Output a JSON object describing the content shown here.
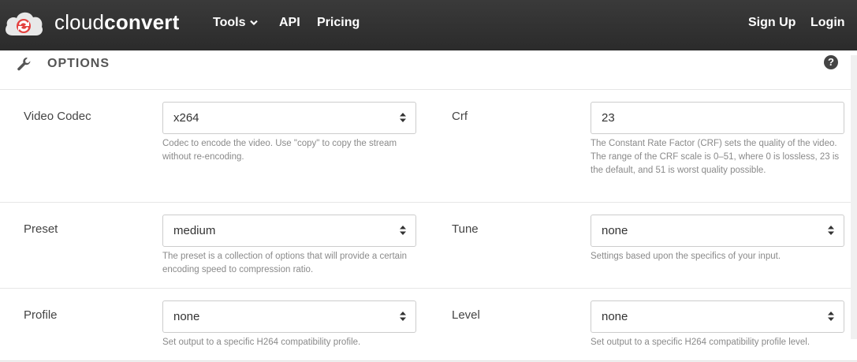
{
  "brand": {
    "light": "cloud",
    "bold": "convert"
  },
  "nav": {
    "tools": "Tools",
    "api": "API",
    "pricing": "Pricing",
    "signup": "Sign Up",
    "login": "Login"
  },
  "options": {
    "title": "OPTIONS",
    "help": "?"
  },
  "fields": {
    "video_codec": {
      "label": "Video Codec",
      "value": "x264",
      "help": "Codec to encode the video. Use \"copy\" to copy the stream without re-encoding."
    },
    "crf": {
      "label": "Crf",
      "value": "23",
      "help": "The Constant Rate Factor (CRF) sets the quality of the video. The range of the CRF scale is 0–51, where 0 is lossless, 23 is the default, and 51 is worst quality possible."
    },
    "preset": {
      "label": "Preset",
      "value": "medium",
      "help": "The preset is a collection of options that will provide a certain encoding speed to compression ratio."
    },
    "tune": {
      "label": "Tune",
      "value": "none",
      "help": "Settings based upon the specifics of your input."
    },
    "profile": {
      "label": "Profile",
      "value": "none",
      "help": "Set output to a specific H264 compatibility profile."
    },
    "level": {
      "label": "Level",
      "value": "none",
      "help": "Set output to a specific H264 compatibility profile level."
    }
  },
  "colors": {
    "topbar": "#2f2f2f",
    "logo_red": "#e3413f"
  }
}
